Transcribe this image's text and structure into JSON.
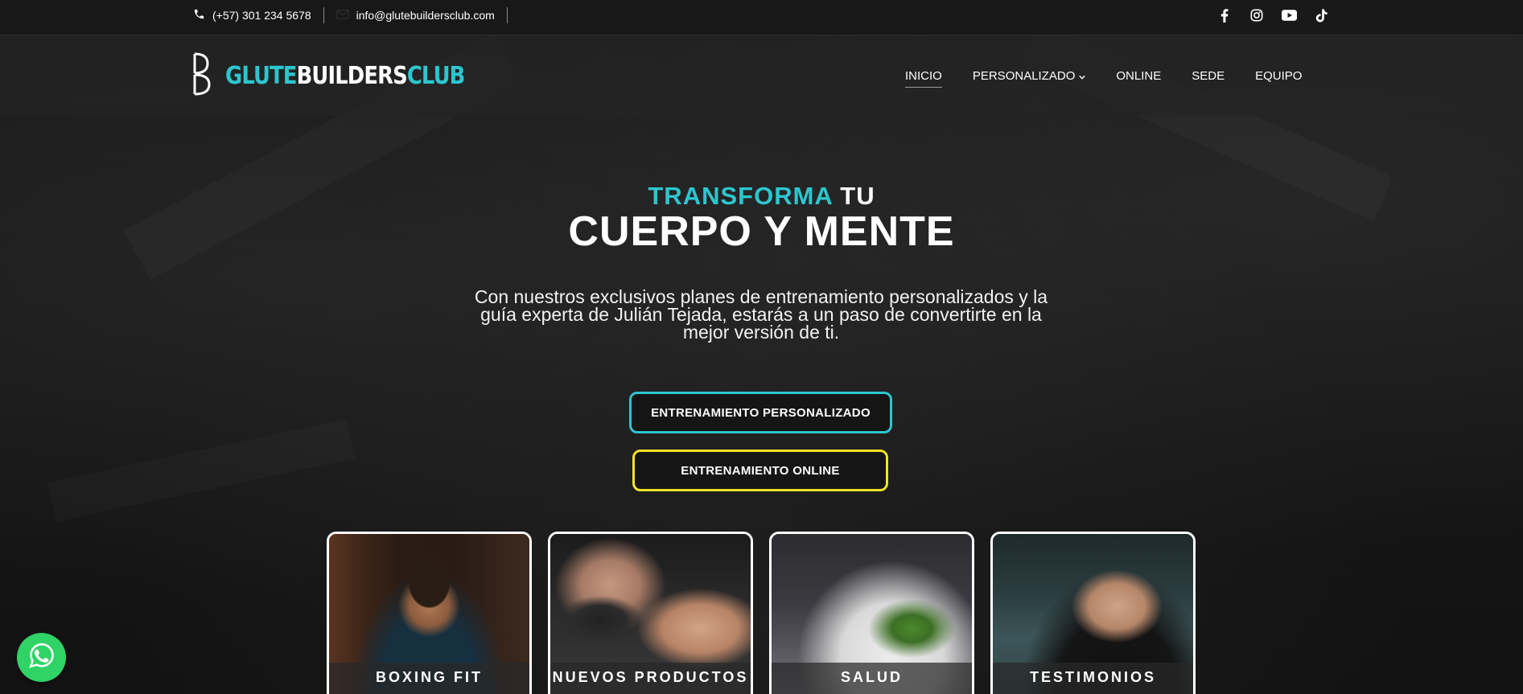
{
  "topbar": {
    "phone": "(+57) 301 234 5678",
    "email": "info@glutebuildersclub.com",
    "social": [
      "facebook-icon",
      "instagram-icon",
      "youtube-icon",
      "tiktok-icon"
    ]
  },
  "header": {
    "logo": {
      "part1": "GLUTE",
      "part2": "BUILDERS",
      "part3": "CLUB"
    },
    "nav": [
      {
        "label": "INICIO",
        "active": true
      },
      {
        "label": "PERSONALIZADO",
        "has_dropdown": true
      },
      {
        "label": "ONLINE"
      },
      {
        "label": "SEDE"
      },
      {
        "label": "EQUIPO"
      }
    ]
  },
  "hero": {
    "title_accent": "TRANSFORMA",
    "title_rest": "TU",
    "subtitle": "CUERPO Y MENTE",
    "description": "Con nuestros exclusivos planes de entrenamiento personalizados y la guía experta de Julián Tejada, estarás a un paso de convertirte en la mejor versión de ti.",
    "buttons": {
      "personalizado": "ENTRENAMIENTO PERSONALIZADO",
      "online": "ENTRENAMIENTO ONLINE"
    }
  },
  "cards": [
    {
      "label": "BOXING FIT"
    },
    {
      "label": "NUEVOS PRODUCTOS"
    },
    {
      "label": "SALUD"
    },
    {
      "label": "TESTIMONIOS"
    }
  ],
  "colors": {
    "accent_cyan": "#2cc6cf",
    "accent_yellow": "#f2e326",
    "whatsapp_green": "#2fd366",
    "background": "#171717"
  }
}
